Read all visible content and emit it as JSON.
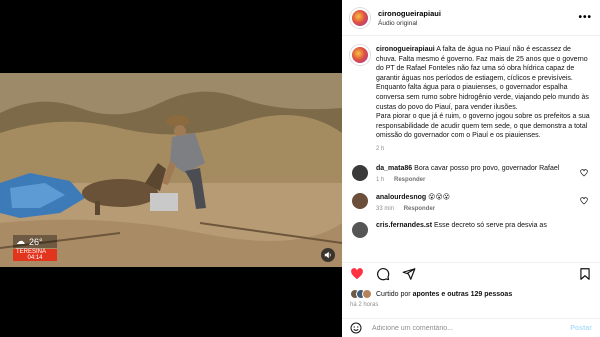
{
  "post": {
    "username": "cironogueirapiaui",
    "audio": "Áudio original",
    "more_icon": "more-horizontal-icon"
  },
  "caption": {
    "username": "cironogueirapiaui",
    "paragraph1": "A falta de água no Piauí não é escassez de chuva. Falta mesmo é governo. Faz mais de 25 anos que o governo do PT de Rafael Fonteles não faz uma só obra hídrica capaz de garantir águas nos períodos de estiagem, cíclicos e previsíveis.",
    "paragraph2": "Enquanto falta água para o piauienses, o governador espalha conversa sem rumo sobre hidrogênio verde, viajando pelo mundo às custas do povo do Piauí, para vender ilusões.",
    "paragraph3": "Para piorar o que já é ruim, o governo jogou sobre os prefeitos a sua responsabilidade de acudir quem tem sede, o que demonstra a total omissão do governador com o Piauí e os piauienses.",
    "time": "2 h"
  },
  "comments": [
    {
      "username": "da_mata86",
      "text": "Bora cavar posso pro povo, governador Rafael",
      "time": "1 h",
      "reply": "Responder",
      "avatar_color": "#3a3a3a"
    },
    {
      "username": "analourdesnog",
      "text": "😮😮😮",
      "time": "33 min",
      "reply": "Responder",
      "avatar_color": "#6b4f3a"
    },
    {
      "username": "cris.fernandes.st",
      "text": "Esse decreto só serve pra desvia as",
      "time": "",
      "reply": "",
      "avatar_color": "#555555"
    }
  ],
  "likes": {
    "prefix": "Curtido por",
    "user": "apontes",
    "suffix": "e outras 129 pessoas",
    "posted": "há 2 horas"
  },
  "add_comment": {
    "placeholder": "Adicione um comentário...",
    "post_label": "Postar"
  },
  "video_overlay": {
    "temperature": "26°",
    "city": "TERESINA",
    "time": "04:14"
  },
  "colors": {
    "like_red": "#ff3040",
    "post_blue": "#b2dffc",
    "meta_gray": "#8e8e8e"
  }
}
